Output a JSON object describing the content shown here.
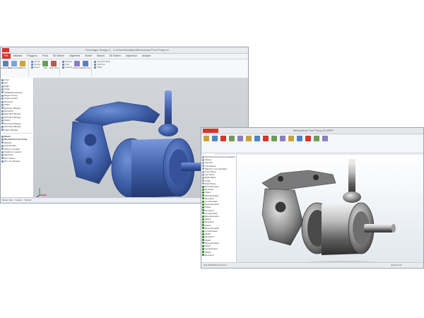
{
  "winA": {
    "title": "Geomagic Design X - C:\\Users\\Desktop\\Mechanical Fuel Pump.xrl",
    "tabs": [
      {
        "label": "File"
      },
      {
        "label": "Initialize"
      },
      {
        "label": "Polygons"
      },
      {
        "label": "Point"
      },
      {
        "label": "3D Sketch"
      },
      {
        "label": "Alignment"
      },
      {
        "label": "Model"
      },
      {
        "label": "Sketch"
      },
      {
        "label": "3D Sketch"
      },
      {
        "label": "Inspection"
      },
      {
        "label": "Analyze"
      }
    ],
    "ribbon_groups": [
      {
        "label": "Create Feature"
      },
      {
        "label": "Create Surface"
      },
      {
        "label": "Wizard"
      },
      {
        "label": "Edit"
      },
      {
        "label": "Body Tools"
      },
      {
        "label": "Reference"
      },
      {
        "label": "Modify Face"
      }
    ],
    "ribbon_list_1": [
      "Extrude",
      "Revolve",
      "Sweep"
    ],
    "ribbon_list_2": [
      "Boolean",
      "Fillet",
      "Chamfer"
    ],
    "ribbon_list_3": [
      "Transform Body",
      "Split Face",
      "Offset"
    ],
    "tree": [
      {
        "label": "Front"
      },
      {
        "label": "Top"
      },
      {
        "label": "Right"
      },
      {
        "label": "Origin"
      },
      {
        "label": "XWMechFuelPump"
      },
      {
        "label": "Region Group"
      },
      {
        "label": "Inspect Group"
      },
      {
        "label": "Revolve1"
      },
      {
        "label": "Fillet1"
      },
      {
        "label": "Extrude1 (Merge)"
      },
      {
        "label": "Revolve2"
      },
      {
        "label": "Extrude2 (Merge)"
      },
      {
        "label": "Extrude3 (Merge)"
      },
      {
        "label": "Fillet2"
      },
      {
        "label": "Revolve3 (Merge)"
      },
      {
        "label": "Extrude4 (Merge)"
      },
      {
        "label": "Fillet3 (Merge)"
      }
    ],
    "tree2": [
      {
        "label": "Model",
        "bold": true
      },
      {
        "label": "Mechanical Fuel Pump",
        "bold": true
      },
      {
        "label": "Meshes"
      },
      {
        "label": "Solid Bodies"
      },
      {
        "label": "Shell (1 created)"
      },
      {
        "label": "Shell2 (1 created)"
      },
      {
        "label": "Sketches"
      },
      {
        "label": "Ref. Planes"
      },
      {
        "label": "Ref. Coordinates"
      }
    ],
    "status": [
      "Model View",
      "Feature",
      "Display"
    ],
    "colors": {
      "mesh": "#3f5fa8",
      "mesh_shadow": "#27407c",
      "mesh_highlight": "#6f8fd6",
      "file_tab": "#d9332b"
    }
  },
  "winB": {
    "title": "Mechanical Fuel Pump.SLDPRT",
    "brand": "SOLIDWORKS",
    "tabs": [
      {
        "label": "Features"
      },
      {
        "label": "Sketch"
      },
      {
        "label": "Evaluate"
      },
      {
        "label": "DimXpert"
      },
      {
        "label": "Add-Ins"
      }
    ],
    "ribbon_buttons": [
      {
        "label": "Extruded Boss/Base"
      },
      {
        "label": "Revolved Boss/Base"
      },
      {
        "label": "Swept Boss/Base"
      },
      {
        "label": "Extruded Cut"
      },
      {
        "label": "Hole Wizard"
      },
      {
        "label": "Revolved Cut"
      },
      {
        "label": "Fillet"
      },
      {
        "label": "Linear Pattern"
      },
      {
        "label": "Rib"
      },
      {
        "label": "Draft"
      },
      {
        "label": "Shell"
      },
      {
        "label": "Mirror"
      },
      {
        "label": "Reference Geometry"
      },
      {
        "label": "Curves"
      },
      {
        "label": "Instant3D"
      }
    ],
    "tree": [
      {
        "label": "Mechanical Fuel Pump (Default)",
        "green": false
      },
      {
        "label": "History",
        "green": false
      },
      {
        "label": "Sensors",
        "green": false
      },
      {
        "label": "Annotations",
        "green": false
      },
      {
        "label": "Material <not specified>",
        "green": false
      },
      {
        "label": "Front Plane",
        "green": false
      },
      {
        "label": "Top Plane",
        "green": false
      },
      {
        "label": "Right Plane",
        "green": false
      },
      {
        "label": "Origin",
        "green": false
      },
      {
        "label": "Mesh Body",
        "green": false
      },
      {
        "label": "Boss-Extrude1",
        "green": true
      },
      {
        "label": "Revolve1",
        "green": true
      },
      {
        "label": "Fillet1",
        "green": true
      },
      {
        "label": "Boss-Extrude2",
        "green": true
      },
      {
        "label": "Revolve2",
        "green": true
      },
      {
        "label": "Cut-Extrude1",
        "green": true
      },
      {
        "label": "Boss-Extrude3",
        "green": true
      },
      {
        "label": "Fillet2",
        "green": true
      },
      {
        "label": "Revolve3",
        "green": true
      },
      {
        "label": "Cut-Extrude2",
        "green": true
      },
      {
        "label": "Boss-Extrude4",
        "green": true
      },
      {
        "label": "Fillet3",
        "green": true
      },
      {
        "label": "Revolve4",
        "green": true
      },
      {
        "label": "Fillet4",
        "green": true
      },
      {
        "label": "Boss-Extrude5",
        "green": true
      },
      {
        "label": "Cut-Extrude3",
        "green": true
      },
      {
        "label": "Fillet5",
        "green": true
      },
      {
        "label": "Revolve5",
        "green": true
      },
      {
        "label": "Fillet6",
        "green": true
      },
      {
        "label": "Boss-Extrude6",
        "green": true
      },
      {
        "label": "Fillet7",
        "green": true
      },
      {
        "label": "Cut-Extrude4",
        "green": true
      },
      {
        "label": "Fillet8",
        "green": true
      },
      {
        "label": "Revolve6",
        "green": true
      }
    ],
    "status_left": "SOLIDWORKS Premium",
    "status_right": "Editing Part",
    "colors": {
      "brand": "#d6342c",
      "feature_icon": "#3d8b3d"
    }
  }
}
